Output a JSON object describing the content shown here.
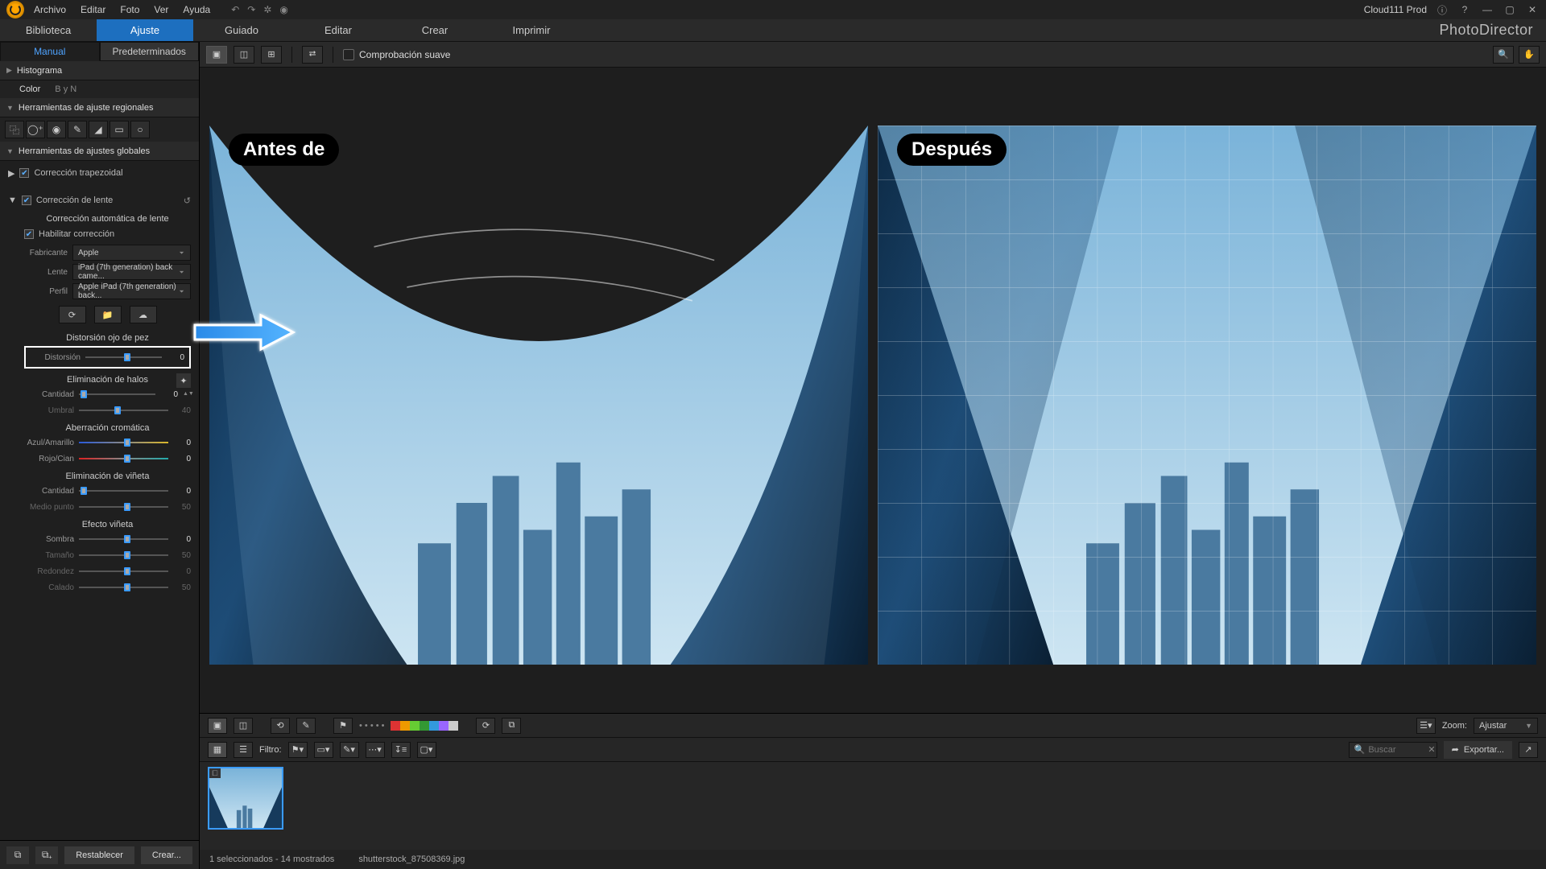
{
  "menu": {
    "items": [
      "Archivo",
      "Editar",
      "Foto",
      "Ver",
      "Ayuda"
    ],
    "user": "Cloud111 Prod"
  },
  "modules": {
    "items": [
      "Biblioteca",
      "Ajuste",
      "Guiado",
      "Editar",
      "Crear",
      "Imprimir"
    ],
    "activeIndex": 1,
    "brand": "PhotoDirector"
  },
  "leftTabs": {
    "manual": "Manual",
    "presets": "Predeterminados"
  },
  "sections": {
    "histogram": "Histograma",
    "regional": "Herramientas de ajuste regionales",
    "global": "Herramientas de ajustes globales"
  },
  "histoSub": {
    "color": "Color",
    "byn": "B y N"
  },
  "trapezoid": {
    "label": "Corrección trapezoidal",
    "checked": true
  },
  "lens": {
    "label": "Corrección de lente",
    "checked": true,
    "autoTitle": "Corrección automática de lente",
    "enable": "Habilitar corrección",
    "maker": {
      "label": "Fabricante",
      "value": "Apple"
    },
    "lensModel": {
      "label": "Lente",
      "value": "iPad (7th generation) back came..."
    },
    "profile": {
      "label": "Perfil",
      "value": "Apple iPad (7th generation) back..."
    }
  },
  "fisheye": {
    "title": "Distorsión ojo de pez",
    "distortion": {
      "label": "Distorsión",
      "value": 0,
      "pos": 50
    }
  },
  "fringe": {
    "title": "Eliminación de halos",
    "amount": {
      "label": "Cantidad",
      "value": 0,
      "pos": 2
    },
    "threshold": {
      "label": "Umbral",
      "value": 40,
      "pos": 40
    }
  },
  "chroma": {
    "title": "Aberración cromática",
    "by": {
      "label": "Azul/Amarillo",
      "value": 0,
      "pos": 50
    },
    "rc": {
      "label": "Rojo/Cian",
      "value": 0,
      "pos": 50
    }
  },
  "vignetteRem": {
    "title": "Eliminación de viñeta",
    "amount": {
      "label": "Cantidad",
      "value": 0,
      "pos": 2
    },
    "mid": {
      "label": "Medio punto",
      "value": 50,
      "pos": 50
    }
  },
  "vignetteEff": {
    "title": "Efecto viñeta",
    "shadow": {
      "label": "Sombra",
      "value": 0,
      "pos": 50
    },
    "size": {
      "label": "Tamaño",
      "value": 50,
      "pos": 50
    },
    "round": {
      "label": "Redondez",
      "value": 0,
      "pos": 50
    },
    "feather": {
      "label": "Calado",
      "value": 50,
      "pos": 50
    }
  },
  "leftFooter": {
    "reset": "Restablecer",
    "create": "Crear..."
  },
  "viewbar": {
    "soft": "Comprobación suave"
  },
  "beforeAfter": {
    "before": "Antes de",
    "after": "Después"
  },
  "strip": {
    "filterLabel": "Filtro:",
    "zoomLabel": "Zoom:",
    "zoomValue": "Ajustar",
    "searchPlaceholder": "Buscar",
    "export": "Exportar..."
  },
  "status": {
    "sel": "1 seleccionados - 14 mostrados",
    "file": "shutterstock_87508369.jpg"
  },
  "swatches": [
    "#d33",
    "#e90",
    "#6c3",
    "#393",
    "#39d",
    "#96f",
    "#ccc"
  ]
}
